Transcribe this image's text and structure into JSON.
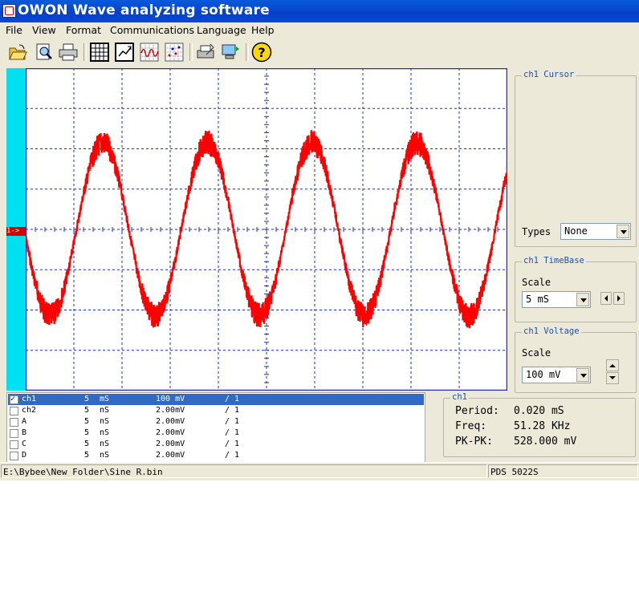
{
  "window": {
    "title": "OWON Wave analyzing software"
  },
  "menu": [
    "File",
    "View",
    "Format",
    "Communications",
    "Language",
    "Help"
  ],
  "toolbar": {
    "icons": [
      "open-folder-icon",
      "print-preview-icon",
      "printer-icon",
      "table-icon",
      "zoom-chart-icon",
      "waveform-icon",
      "scatter-chart-icon",
      "print-setup-icon",
      "connect-icon",
      "help-icon"
    ],
    "help_glyph": "?"
  },
  "scope": {
    "channel_marker": "1->",
    "trace_color": "#ff0000",
    "grid_color": "#1f2fb8",
    "channel_bar_color": "#00e0f0",
    "waveform": {
      "cycles": 4.6,
      "noise": "high"
    }
  },
  "cursor_panel": {
    "title": "ch1 Cursor",
    "types_label": "Types",
    "types_value": "None"
  },
  "timebase_panel": {
    "title": "ch1 TimeBase",
    "scale_label": "Scale",
    "scale_value": "5  mS"
  },
  "voltage_panel": {
    "title": "ch1 Voltage",
    "scale_label": "Scale",
    "scale_value": "100 mV"
  },
  "channels": [
    {
      "name": "ch1",
      "time": "5",
      "tunit": "mS",
      "volt": "100 mV",
      "div": "/ 1",
      "checked": true,
      "selected": true
    },
    {
      "name": "ch2",
      "time": "5",
      "tunit": "nS",
      "volt": "2.00mV",
      "div": "/ 1",
      "checked": false,
      "selected": false
    },
    {
      "name": "A",
      "time": "5",
      "tunit": "nS",
      "volt": "2.00mV",
      "div": "/ 1",
      "checked": false,
      "selected": false
    },
    {
      "name": "B",
      "time": "5",
      "tunit": "nS",
      "volt": "2.00mV",
      "div": "/ 1",
      "checked": false,
      "selected": false
    },
    {
      "name": "C",
      "time": "5",
      "tunit": "nS",
      "volt": "2.00mV",
      "div": "/ 1",
      "checked": false,
      "selected": false
    },
    {
      "name": "D",
      "time": "5",
      "tunit": "nS",
      "volt": "2.00mV",
      "div": "/ 1",
      "checked": false,
      "selected": false
    }
  ],
  "measure": {
    "title": "ch1",
    "period_label": "Period:",
    "period_value": "0.020 mS",
    "freq_label": "Freq:",
    "freq_value": "51.28 KHz",
    "pkpk_label": "PK-PK:",
    "pkpk_value": "528.000 mV"
  },
  "status": {
    "path": "E:\\Bybee\\New Folder\\Sine R.bin",
    "device": "PDS 5022S"
  }
}
